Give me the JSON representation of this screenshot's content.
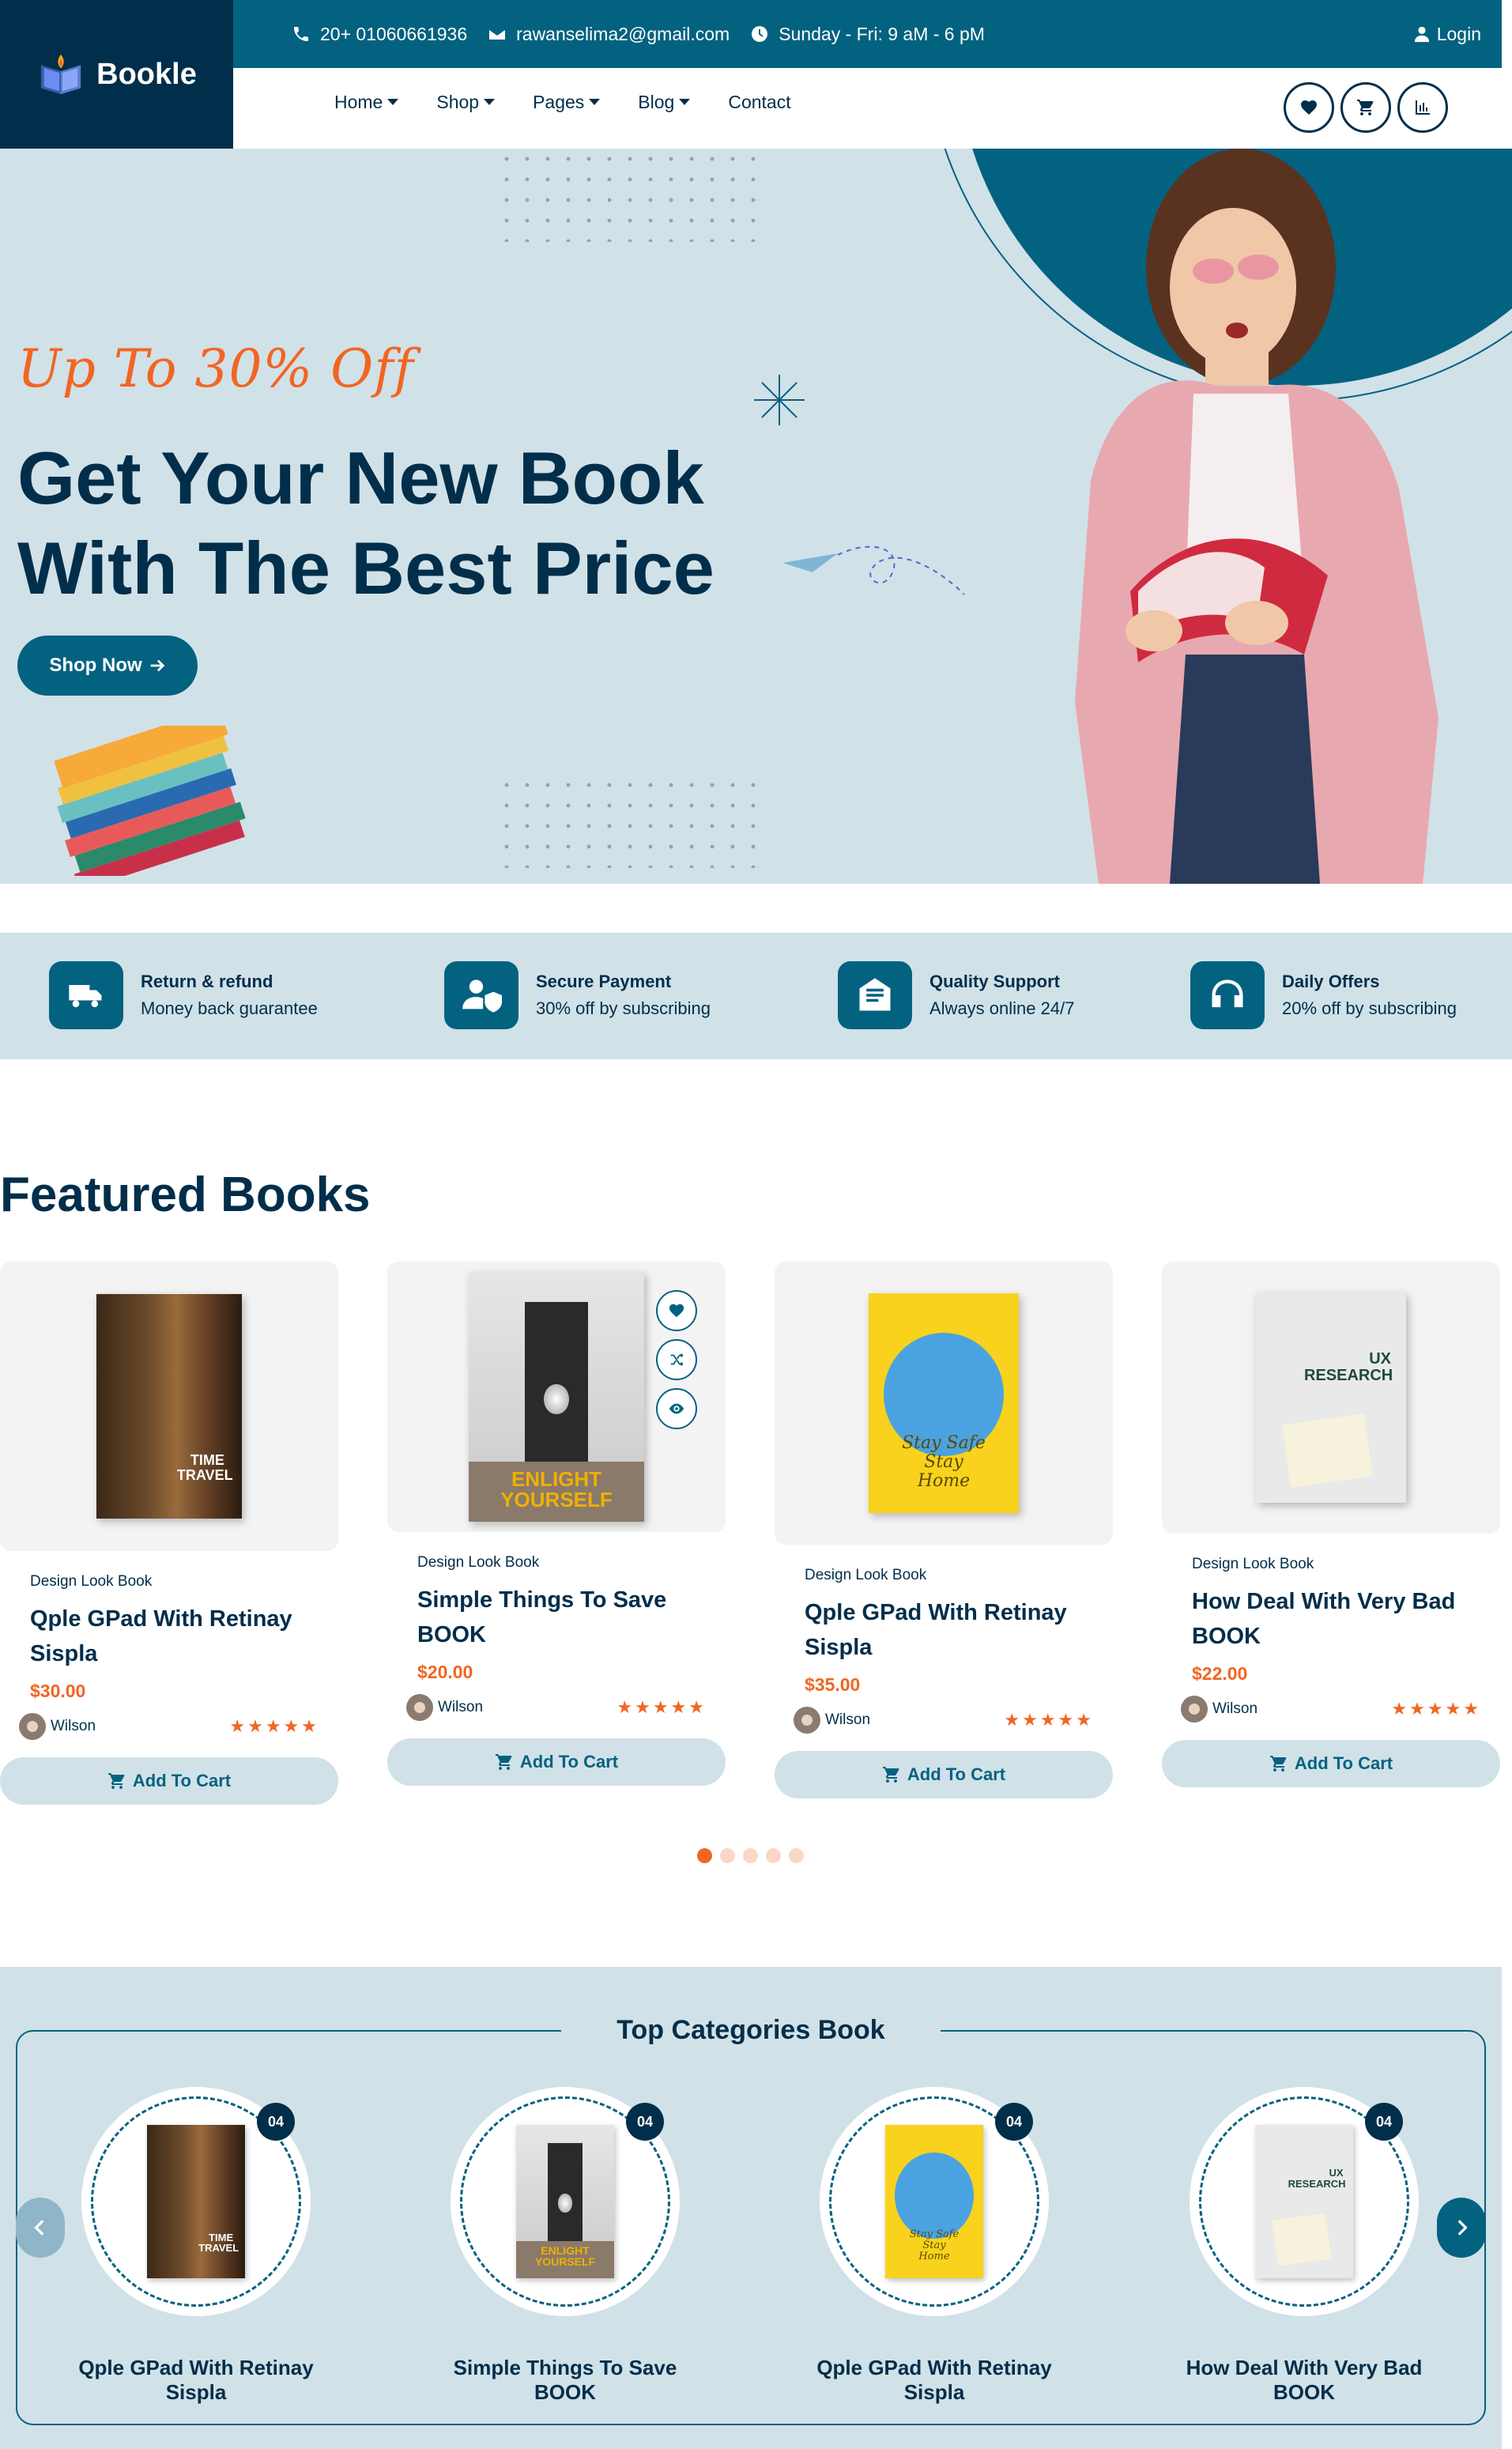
{
  "brand": {
    "name": "Bookle"
  },
  "topbar": {
    "phone": "20+ 01060661936",
    "email": "rawanselima2@gmail.com",
    "hours": "Sunday - Fri: 9 aM - 6 pM",
    "login": "Login"
  },
  "nav": {
    "items": [
      "Home",
      "Shop",
      "Pages",
      "Blog",
      "Contact"
    ]
  },
  "hero": {
    "subtitle": "Up To 30% Off",
    "title_line1": "Get Your New Book",
    "title_line2": "With The Best Price",
    "cta": "Shop Now"
  },
  "features": [
    {
      "title": "Return & refund",
      "desc": "Money back guarantee",
      "icon": "truck-icon"
    },
    {
      "title": "Secure Payment",
      "desc": "30% off by subscribing",
      "icon": "secure-user-icon"
    },
    {
      "title": "Quality Support",
      "desc": "Always online 24/7",
      "icon": "mail-support-icon"
    },
    {
      "title": "Daily Offers",
      "desc": "20% off by subscribing",
      "icon": "headphones-icon"
    }
  ],
  "featured": {
    "title": "Featured Books",
    "cards": [
      {
        "category": "Design Look Book",
        "title": "Qple GPad With Retinay Sispla",
        "price": "$30.00",
        "author": "Wilson",
        "cover_text": "TIME TRAVEL",
        "cart": "Add To Cart"
      },
      {
        "category": "Design Look Book",
        "title": "Simple Things To Save BOOK",
        "price": "$20.00",
        "author": "Wilson",
        "cover_text": "ENLIGHT YOURSELF",
        "cart": "Add To Cart"
      },
      {
        "category": "Design Look Book",
        "title": "Qple GPad With Retinay Sispla",
        "price": "$35.00",
        "author": "Wilson",
        "cover_text": "Stay Safe Stay Home",
        "cart": "Add To Cart"
      },
      {
        "category": "Design Look Book",
        "title": "How Deal With Very Bad BOOK",
        "price": "$22.00",
        "author": "Wilson",
        "cover_text": "UX RESEARCH",
        "cart": "Add To Cart"
      }
    ],
    "rating": 5,
    "pager_count": 5,
    "pager_active": 0
  },
  "categories": {
    "title": "Top Categories Book",
    "items": [
      {
        "name": "Qple GPad With Retinay Sispla",
        "count": "04",
        "cover_text": "TIME TRAVEL"
      },
      {
        "name": "Simple Things To Save BOOK",
        "count": "04",
        "cover_text": "ENLIGHT YOURSELF"
      },
      {
        "name": "Qple GPad With Retinay Sispla",
        "count": "04",
        "cover_text": "Stay Safe Stay Home"
      },
      {
        "name": "How Deal With Very Bad BOOK",
        "count": "04",
        "cover_text": "UX RESEARCH"
      }
    ]
  },
  "colors": {
    "primary": "#036280",
    "dark": "#012e4a",
    "accent": "#f26522",
    "light_bg": "#d1e1e8"
  }
}
